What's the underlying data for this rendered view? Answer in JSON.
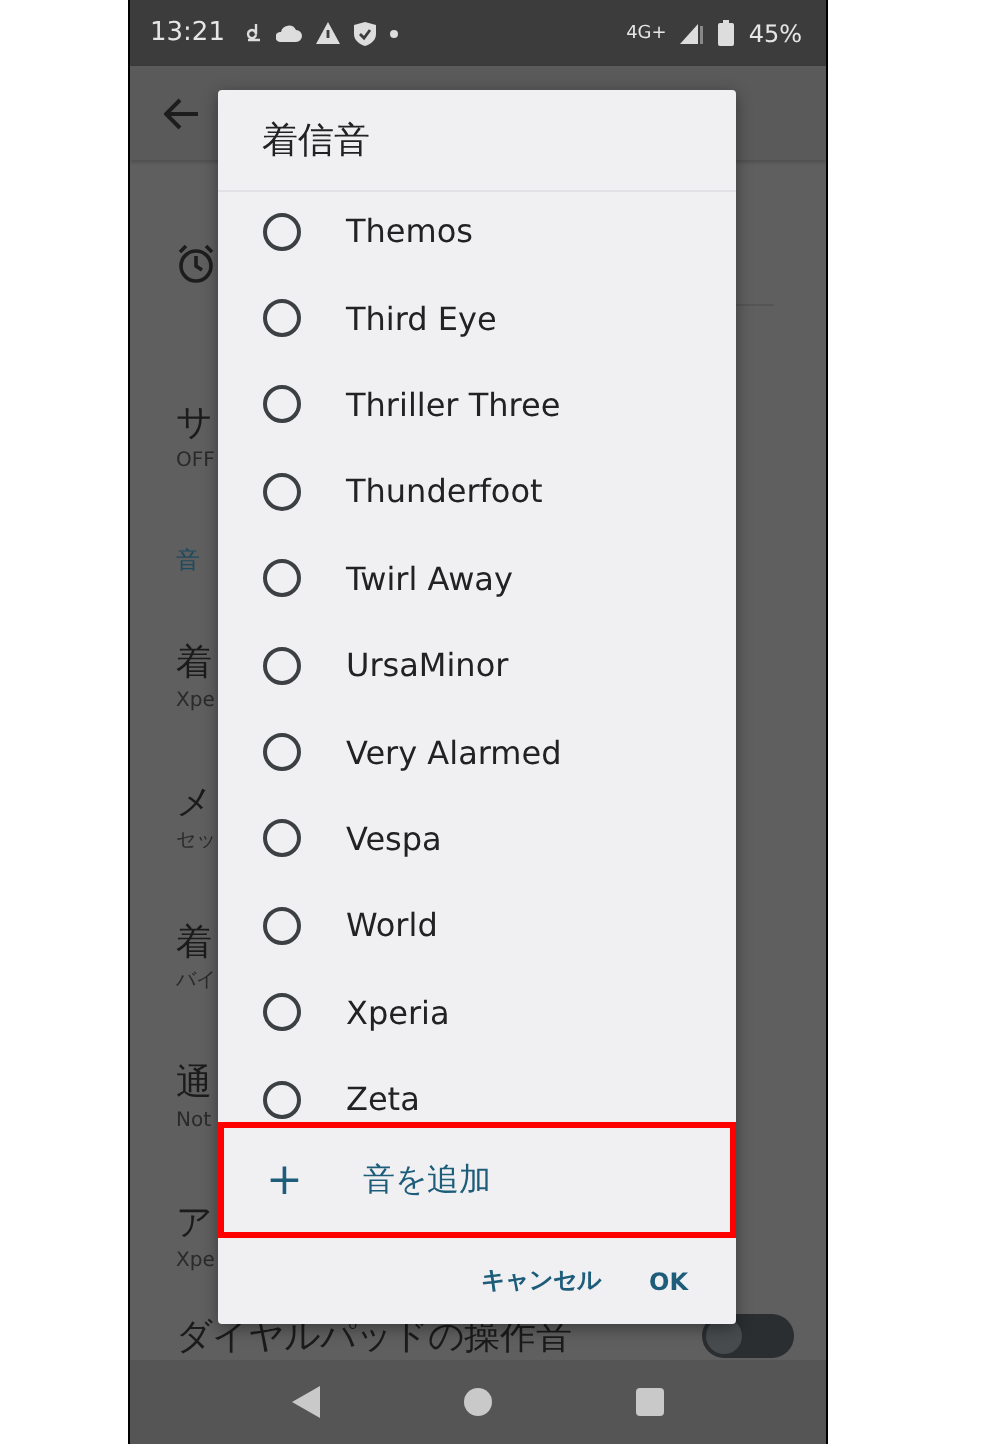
{
  "status_bar": {
    "time": "13:21",
    "network": "4G+",
    "battery": "45%"
  },
  "background": {
    "rows": [
      {
        "kind": "item",
        "title": "サ",
        "subtitle": "OFF"
      },
      {
        "kind": "header",
        "title": "音"
      },
      {
        "kind": "item",
        "title": "着",
        "subtitle": "Xpe"
      },
      {
        "kind": "item",
        "title": "メ",
        "subtitle": "セッ"
      },
      {
        "kind": "item",
        "title": "着",
        "subtitle": "バイ"
      },
      {
        "kind": "item",
        "title": "通",
        "subtitle": "Not"
      },
      {
        "kind": "item",
        "title": "ア",
        "subtitle": "Xpe"
      }
    ],
    "switch_row": {
      "title": "ダイヤルパッドの操作音",
      "on": false
    }
  },
  "dialog": {
    "title": "着信音",
    "options": [
      {
        "label": "Themos",
        "selected": false
      },
      {
        "label": "Third Eye",
        "selected": false
      },
      {
        "label": "Thriller Three",
        "selected": false
      },
      {
        "label": "Thunderfoot",
        "selected": false
      },
      {
        "label": "Twirl Away",
        "selected": false
      },
      {
        "label": "UrsaMinor",
        "selected": false
      },
      {
        "label": "Very Alarmed",
        "selected": false
      },
      {
        "label": "Vespa",
        "selected": false
      },
      {
        "label": "World",
        "selected": false
      },
      {
        "label": "Xperia",
        "selected": false
      },
      {
        "label": "Zeta",
        "selected": false
      }
    ],
    "add": {
      "icon": "+",
      "label": "音を追加",
      "highlighted": true
    },
    "buttons": [
      "キャンセル",
      "OK"
    ]
  }
}
